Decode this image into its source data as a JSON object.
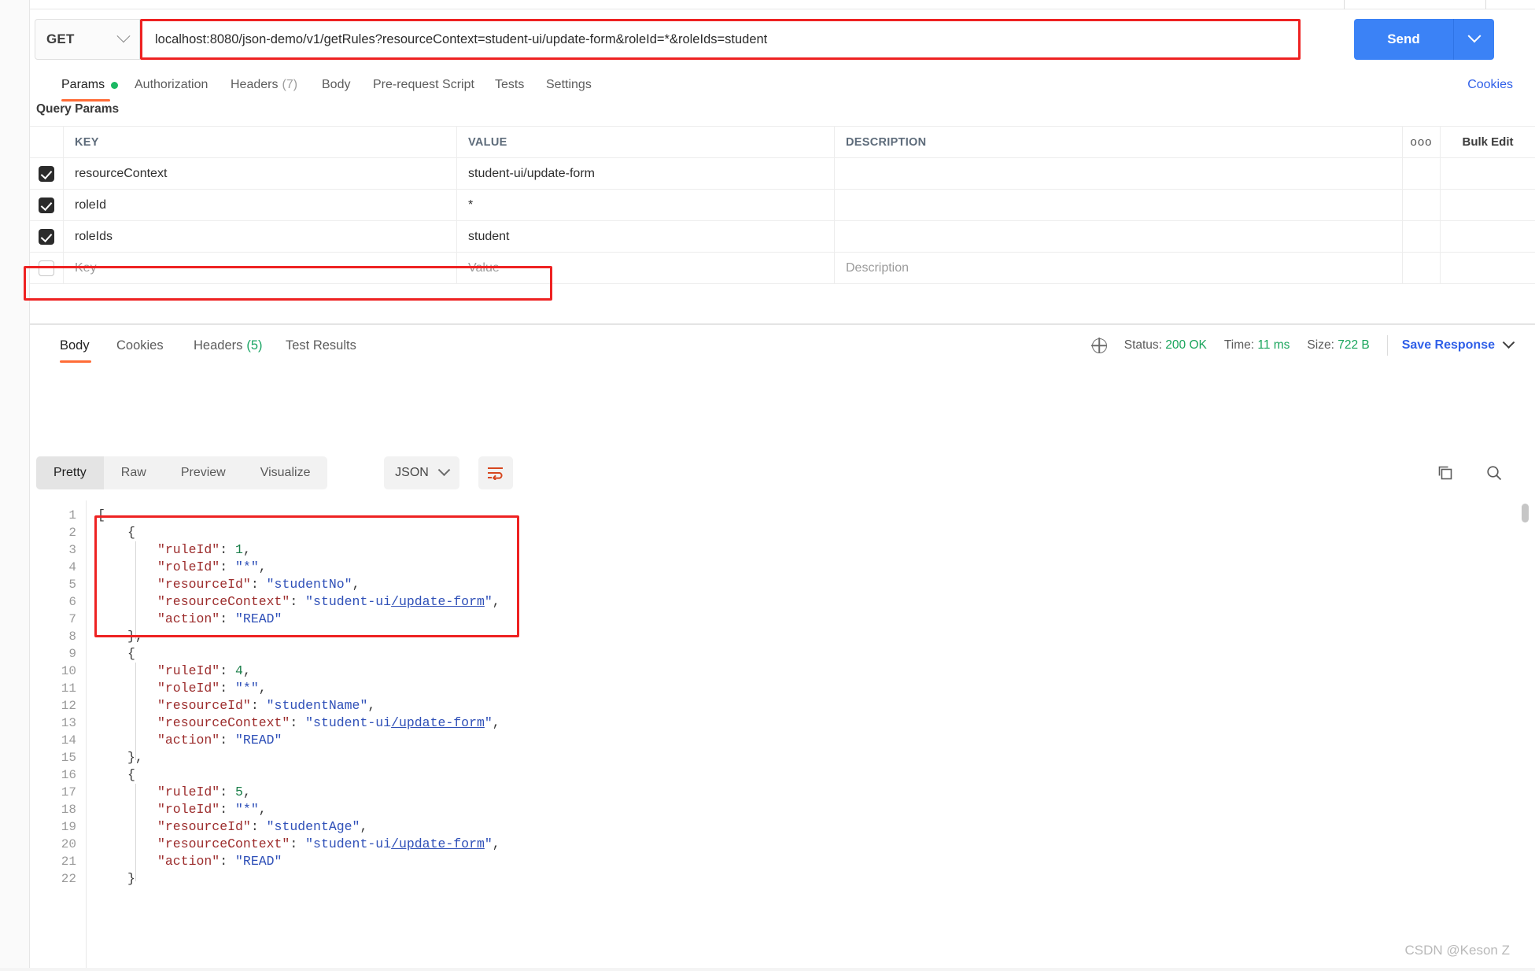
{
  "request": {
    "method": "GET",
    "url": "localhost:8080/json-demo/v1/getRules?resourceContext=student-ui/update-form&roleId=*&roleIds=student",
    "send_label": "Send",
    "tabs": [
      {
        "label": "Params",
        "badge": "",
        "dot": true,
        "active": true
      },
      {
        "label": "Authorization",
        "badge": "",
        "dot": false,
        "active": false
      },
      {
        "label": "Headers",
        "badge": "(7)",
        "dot": false,
        "active": false
      },
      {
        "label": "Body",
        "badge": "",
        "dot": false,
        "active": false
      },
      {
        "label": "Pre-request Script",
        "badge": "",
        "dot": false,
        "active": false
      },
      {
        "label": "Tests",
        "badge": "",
        "dot": false,
        "active": false
      },
      {
        "label": "Settings",
        "badge": "",
        "dot": false,
        "active": false
      }
    ],
    "cookies_link": "Cookies"
  },
  "query_params": {
    "section_title": "Query Params",
    "columns": [
      "KEY",
      "VALUE",
      "DESCRIPTION"
    ],
    "dots_icon": "ooo",
    "bulk_edit_label": "Bulk Edit",
    "rows": [
      {
        "checked": true,
        "key": "resourceContext",
        "value": "student-ui/update-form",
        "description": ""
      },
      {
        "checked": true,
        "key": "roleId",
        "value": "*",
        "description": ""
      },
      {
        "checked": true,
        "key": "roleIds",
        "value": "student",
        "description": "",
        "highlighted": true
      }
    ],
    "empty_row": {
      "key_placeholder": "Key",
      "value_placeholder": "Value",
      "description_placeholder": "Description"
    }
  },
  "response": {
    "tabs": [
      {
        "label": "Body",
        "badge": "",
        "active": true
      },
      {
        "label": "Cookies",
        "badge": "",
        "active": false
      },
      {
        "label": "Headers",
        "badge": "(5)",
        "active": false
      },
      {
        "label": "Test Results",
        "badge": "",
        "active": false
      }
    ],
    "status_label": "Status:",
    "status_value": "200 OK",
    "time_label": "Time:",
    "time_value": "11 ms",
    "size_label": "Size:",
    "size_value": "722 B",
    "save_response_label": "Save Response",
    "view_modes": [
      {
        "label": "Pretty",
        "active": true
      },
      {
        "label": "Raw",
        "active": false
      },
      {
        "label": "Preview",
        "active": false
      },
      {
        "label": "Visualize",
        "active": false
      }
    ],
    "format": "JSON",
    "icons": {
      "wrap": "word-wrap-icon",
      "copy": "copy-icon",
      "search": "search-icon",
      "globe": "globe-icon"
    }
  },
  "body_code": {
    "line_count": 22,
    "lines": [
      {
        "n": 1,
        "indent": 0,
        "tokens": [
          {
            "t": "[",
            "c": "pun"
          }
        ]
      },
      {
        "n": 2,
        "indent": 1,
        "tokens": [
          {
            "t": "{",
            "c": "pun"
          }
        ]
      },
      {
        "n": 3,
        "indent": 2,
        "tokens": [
          {
            "t": "\"ruleId\"",
            "c": "key"
          },
          {
            "t": ": ",
            "c": "pun"
          },
          {
            "t": "1",
            "c": "num"
          },
          {
            "t": ",",
            "c": "pun"
          }
        ]
      },
      {
        "n": 4,
        "indent": 2,
        "tokens": [
          {
            "t": "\"roleId\"",
            "c": "key"
          },
          {
            "t": ": ",
            "c": "pun"
          },
          {
            "t": "\"*\"",
            "c": "str"
          },
          {
            "t": ",",
            "c": "pun"
          }
        ]
      },
      {
        "n": 5,
        "indent": 2,
        "tokens": [
          {
            "t": "\"resourceId\"",
            "c": "key"
          },
          {
            "t": ": ",
            "c": "pun"
          },
          {
            "t": "\"studentNo\"",
            "c": "str"
          },
          {
            "t": ",",
            "c": "pun"
          }
        ]
      },
      {
        "n": 6,
        "indent": 2,
        "tokens": [
          {
            "t": "\"resourceContext\"",
            "c": "key"
          },
          {
            "t": ": ",
            "c": "pun"
          },
          {
            "t": "\"student-ui",
            "c": "str"
          },
          {
            "t": "/update-form",
            "c": "str-u"
          },
          {
            "t": "\"",
            "c": "str"
          },
          {
            "t": ",",
            "c": "pun"
          }
        ]
      },
      {
        "n": 7,
        "indent": 2,
        "tokens": [
          {
            "t": "\"action\"",
            "c": "key"
          },
          {
            "t": ": ",
            "c": "pun"
          },
          {
            "t": "\"READ\"",
            "c": "str"
          }
        ]
      },
      {
        "n": 8,
        "indent": 1,
        "tokens": [
          {
            "t": "},",
            "c": "pun"
          }
        ]
      },
      {
        "n": 9,
        "indent": 1,
        "tokens": [
          {
            "t": "{",
            "c": "pun"
          }
        ]
      },
      {
        "n": 10,
        "indent": 2,
        "tokens": [
          {
            "t": "\"ruleId\"",
            "c": "key"
          },
          {
            "t": ": ",
            "c": "pun"
          },
          {
            "t": "4",
            "c": "num"
          },
          {
            "t": ",",
            "c": "pun"
          }
        ]
      },
      {
        "n": 11,
        "indent": 2,
        "tokens": [
          {
            "t": "\"roleId\"",
            "c": "key"
          },
          {
            "t": ": ",
            "c": "pun"
          },
          {
            "t": "\"*\"",
            "c": "str"
          },
          {
            "t": ",",
            "c": "pun"
          }
        ]
      },
      {
        "n": 12,
        "indent": 2,
        "tokens": [
          {
            "t": "\"resourceId\"",
            "c": "key"
          },
          {
            "t": ": ",
            "c": "pun"
          },
          {
            "t": "\"studentName\"",
            "c": "str"
          },
          {
            "t": ",",
            "c": "pun"
          }
        ]
      },
      {
        "n": 13,
        "indent": 2,
        "tokens": [
          {
            "t": "\"resourceContext\"",
            "c": "key"
          },
          {
            "t": ": ",
            "c": "pun"
          },
          {
            "t": "\"student-ui",
            "c": "str"
          },
          {
            "t": "/update-form",
            "c": "str-u"
          },
          {
            "t": "\"",
            "c": "str"
          },
          {
            "t": ",",
            "c": "pun"
          }
        ]
      },
      {
        "n": 14,
        "indent": 2,
        "tokens": [
          {
            "t": "\"action\"",
            "c": "key"
          },
          {
            "t": ": ",
            "c": "pun"
          },
          {
            "t": "\"READ\"",
            "c": "str"
          }
        ]
      },
      {
        "n": 15,
        "indent": 1,
        "tokens": [
          {
            "t": "},",
            "c": "pun"
          }
        ]
      },
      {
        "n": 16,
        "indent": 1,
        "tokens": [
          {
            "t": "{",
            "c": "pun"
          }
        ]
      },
      {
        "n": 17,
        "indent": 2,
        "tokens": [
          {
            "t": "\"ruleId\"",
            "c": "key"
          },
          {
            "t": ": ",
            "c": "pun"
          },
          {
            "t": "5",
            "c": "num"
          },
          {
            "t": ",",
            "c": "pun"
          }
        ]
      },
      {
        "n": 18,
        "indent": 2,
        "tokens": [
          {
            "t": "\"roleId\"",
            "c": "key"
          },
          {
            "t": ": ",
            "c": "pun"
          },
          {
            "t": "\"*\"",
            "c": "str"
          },
          {
            "t": ",",
            "c": "pun"
          }
        ]
      },
      {
        "n": 19,
        "indent": 2,
        "tokens": [
          {
            "t": "\"resourceId\"",
            "c": "key"
          },
          {
            "t": ": ",
            "c": "pun"
          },
          {
            "t": "\"studentAge\"",
            "c": "str"
          },
          {
            "t": ",",
            "c": "pun"
          }
        ]
      },
      {
        "n": 20,
        "indent": 2,
        "tokens": [
          {
            "t": "\"resourceContext\"",
            "c": "key"
          },
          {
            "t": ": ",
            "c": "pun"
          },
          {
            "t": "\"student-ui",
            "c": "str"
          },
          {
            "t": "/update-form",
            "c": "str-u"
          },
          {
            "t": "\"",
            "c": "str"
          },
          {
            "t": ",",
            "c": "pun"
          }
        ]
      },
      {
        "n": 21,
        "indent": 2,
        "tokens": [
          {
            "t": "\"action\"",
            "c": "key"
          },
          {
            "t": ": ",
            "c": "pun"
          },
          {
            "t": "\"READ\"",
            "c": "str"
          }
        ]
      },
      {
        "n": 22,
        "indent": 1,
        "tokens": [
          {
            "t": "}",
            "c": "pun"
          }
        ]
      }
    ]
  },
  "watermark": "CSDN @Keson Z",
  "colors": {
    "accent": "#ff6c37",
    "send": "#3b82f6",
    "link": "#2f5fe8",
    "success": "#1aa55c",
    "highlight": "#ee2222"
  }
}
